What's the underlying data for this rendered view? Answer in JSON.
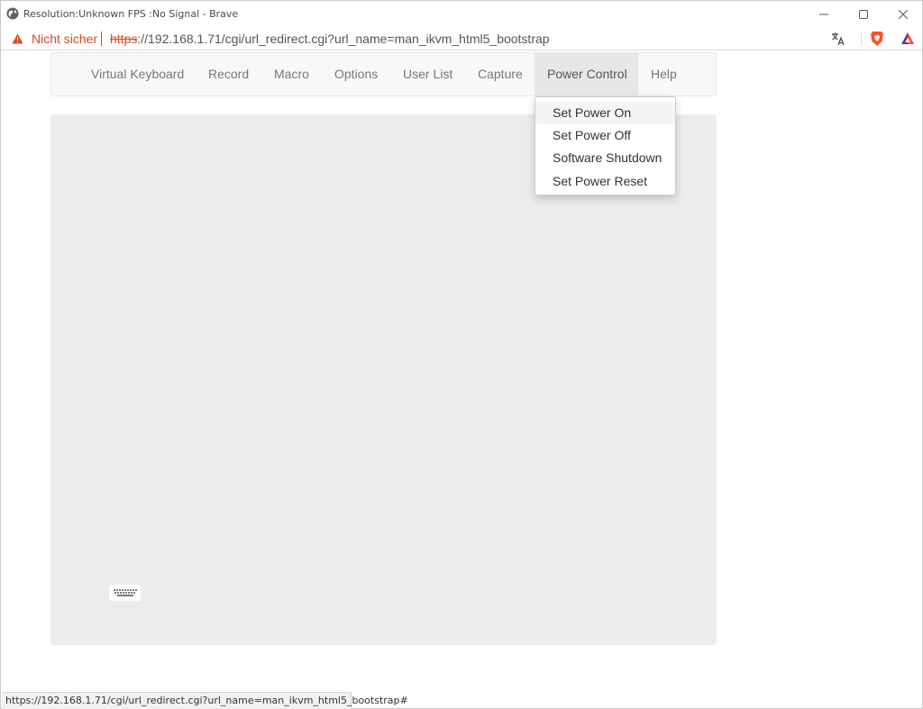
{
  "window": {
    "title": "Resolution:Unknown FPS :No Signal - Brave"
  },
  "addressbar": {
    "security_label": "Nicht sicher",
    "url_scheme": "https",
    "url_rest": "://192.168.1.71/cgi/url_redirect.cgi?url_name=man_ikvm_html5_bootstrap"
  },
  "navbar": {
    "items": [
      {
        "label": "Virtual Keyboard"
      },
      {
        "label": "Record"
      },
      {
        "label": "Macro"
      },
      {
        "label": "Options"
      },
      {
        "label": "User List"
      },
      {
        "label": "Capture"
      },
      {
        "label": "Power Control",
        "active": true
      },
      {
        "label": "Help"
      }
    ]
  },
  "power_menu": {
    "items": [
      {
        "label": "Set Power On"
      },
      {
        "label": "Set Power Off"
      },
      {
        "label": "Software Shutdown"
      },
      {
        "label": "Set Power Reset"
      }
    ]
  },
  "statusbar": {
    "url": "https://192.168.1.71/cgi/url_redirect.cgi?url_name=man_ikvm_html5_bootstrap#"
  },
  "icons": {
    "globe": "globe-icon",
    "warning": "warning-icon",
    "translate": "translate-icon",
    "brave": "brave-shield-icon",
    "rewards": "brave-rewards-icon",
    "keyboard": "keyboard-icon"
  },
  "colors": {
    "insecure": "#d54a1f",
    "navbar_bg": "#f8f8f8",
    "active_tab_bg": "#e7e7e7",
    "viewport_bg": "#ececec",
    "brave": "#fb542b"
  }
}
